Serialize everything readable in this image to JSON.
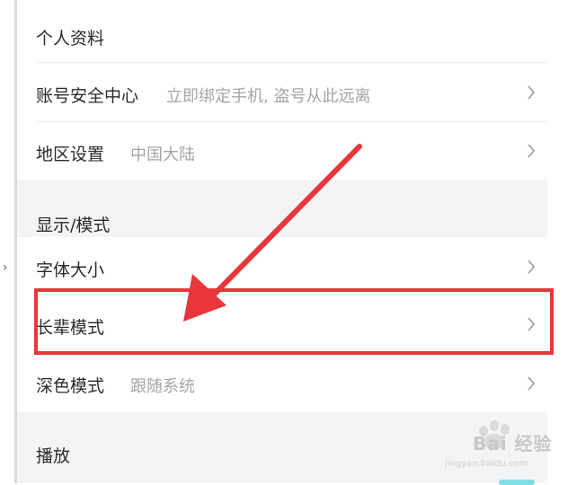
{
  "settings": {
    "items": [
      {
        "label": "个人资料",
        "sub": ""
      },
      {
        "label": "账号安全中心",
        "sub": "立即绑定手机, 盗号从此远离"
      },
      {
        "label": "地区设置",
        "sub": "中国大陆"
      },
      {
        "label": "字体大小",
        "sub": ""
      },
      {
        "label": "长辈模式",
        "sub": ""
      },
      {
        "label": "深色模式",
        "sub": "跟随系统"
      }
    ],
    "sections": {
      "display": "显示/模式",
      "playback": "播放"
    }
  },
  "annotation": {
    "highlight_color": "#e8363a"
  },
  "watermark": {
    "brand": "Bai 经验",
    "url": "jingyan.baidu.com"
  },
  "colors": {
    "page_bg": "#f3f4f6",
    "row_bg": "#ffffff",
    "label": "#2b2b2b",
    "sub": "#a5a5a5"
  }
}
